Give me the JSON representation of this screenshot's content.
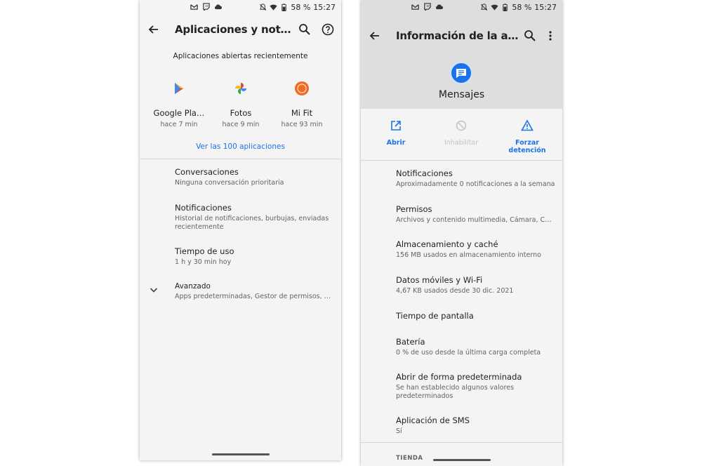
{
  "left": {
    "status": {
      "battery": "58 %",
      "time": "15:27"
    },
    "toolbar": {
      "title": "Aplicaciones y notificaci…"
    },
    "recent_title": "Aplicaciones abiertas recientemente",
    "recent_apps": [
      {
        "name": "Google Pla…",
        "time": "hace 7 min",
        "icon": "google-play-icon"
      },
      {
        "name": "Fotos",
        "time": "hace 9 min",
        "icon": "google-photos-icon"
      },
      {
        "name": "Mi Fit",
        "time": "hace 93 min",
        "icon": "mi-fit-icon"
      }
    ],
    "see_all": "Ver las 100 aplicaciones",
    "items": [
      {
        "title": "Conversaciones",
        "subtitle": "Ninguna conversación prioritaria"
      },
      {
        "title": "Notificaciones",
        "subtitle": "Historial de notificaciones, burbujas, enviadas recientemente"
      },
      {
        "title": "Tiempo de uso",
        "subtitle": "1 h y 30 min hoy"
      },
      {
        "title": "Avanzado",
        "subtitle": "Apps predeterminadas, Gestor de permisos, Alerta…"
      }
    ]
  },
  "right": {
    "status": {
      "battery": "58 %",
      "time": "15:27"
    },
    "toolbar": {
      "title": "Información de la aplicac…"
    },
    "app_name": "Mensajes",
    "actions": [
      {
        "label": "Abrir",
        "icon": "open-external-icon",
        "enabled": true
      },
      {
        "label": "Inhabilitar",
        "icon": "disable-icon",
        "enabled": false
      },
      {
        "label": "Forzar detención",
        "icon": "warning-icon",
        "enabled": true
      }
    ],
    "items": [
      {
        "title": "Notificaciones",
        "subtitle": "Aproximadamente 0 notificaciones a la semana"
      },
      {
        "title": "Permisos",
        "subtitle": "Archivos y contenido multimedia, Cámara, Contact…"
      },
      {
        "title": "Almacenamiento y caché",
        "subtitle": "156 MB usados en almacenamiento interno"
      },
      {
        "title": "Datos móviles y Wi-Fi",
        "subtitle": "4,67 KB usados desde 30 dic. 2021"
      },
      {
        "title": "Tiempo de pantalla",
        "subtitle": ""
      },
      {
        "title": "Batería",
        "subtitle": "0 % de uso desde la última carga completa"
      },
      {
        "title": "Abrir de forma predeterminada",
        "subtitle": "Se han establecido algunos valores predeterminados"
      },
      {
        "title": "Aplicación de SMS",
        "subtitle": "Sí"
      }
    ],
    "section_label": "TIENDA"
  },
  "colors": {
    "accent": "#1a73e8",
    "background": "#f4f4f4",
    "header_grey": "#dedede",
    "disabled": "#c2c2c2"
  }
}
